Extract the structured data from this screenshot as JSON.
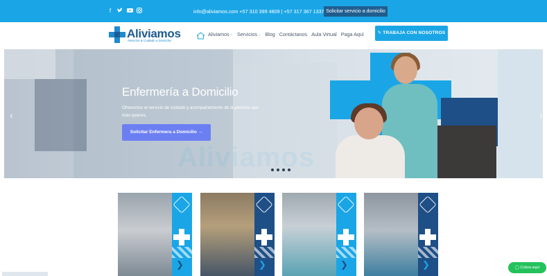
{
  "topbar": {
    "social_icons": [
      "facebook-icon",
      "twitter-icon",
      "youtube-icon",
      "instagram-icon"
    ],
    "contact": "info@aliviamos.com  +57 310 399 4809 | +57 317 367 1337",
    "cta": "Solicitar servicio a domicilio"
  },
  "header": {
    "logo_name": "Aliviamos",
    "logo_tagline": "Atención & Cuidado a Domicilio",
    "nav": [
      {
        "label": "Aliviamos",
        "has_dropdown": true
      },
      {
        "label": "Servicios",
        "has_dropdown": true
      },
      {
        "label": "Blog",
        "has_dropdown": false
      },
      {
        "label": "Contáctanos",
        "has_dropdown": false
      },
      {
        "label": "Aula Virtual",
        "has_dropdown": false
      },
      {
        "label": "Paga Aquí",
        "has_dropdown": false
      }
    ],
    "work_button": "✎ TRABAJA CON NOSOTROS"
  },
  "hero": {
    "title": "Enfermería a Domicilio",
    "subtitle": "Ofrecemos el servicio de cuidado y acompañamiento de la persona que más quieres.",
    "button": "Solicitar Enfermera a Domicilio →",
    "arrow_left": "‹",
    "arrow_right": "›",
    "slide_count": 4
  },
  "watermark": "Aliviamos",
  "cards": [
    {
      "strip": "light"
    },
    {
      "strip": "dark"
    },
    {
      "strip": "light"
    },
    {
      "strip": "dark"
    }
  ],
  "chat_button": "Cotiza aquí",
  "colors": {
    "brand_blue": "#1aa6e6",
    "brand_navy": "#1e4f86",
    "hero_button": "#6c7ff2",
    "whatsapp_green": "#25c25c"
  }
}
